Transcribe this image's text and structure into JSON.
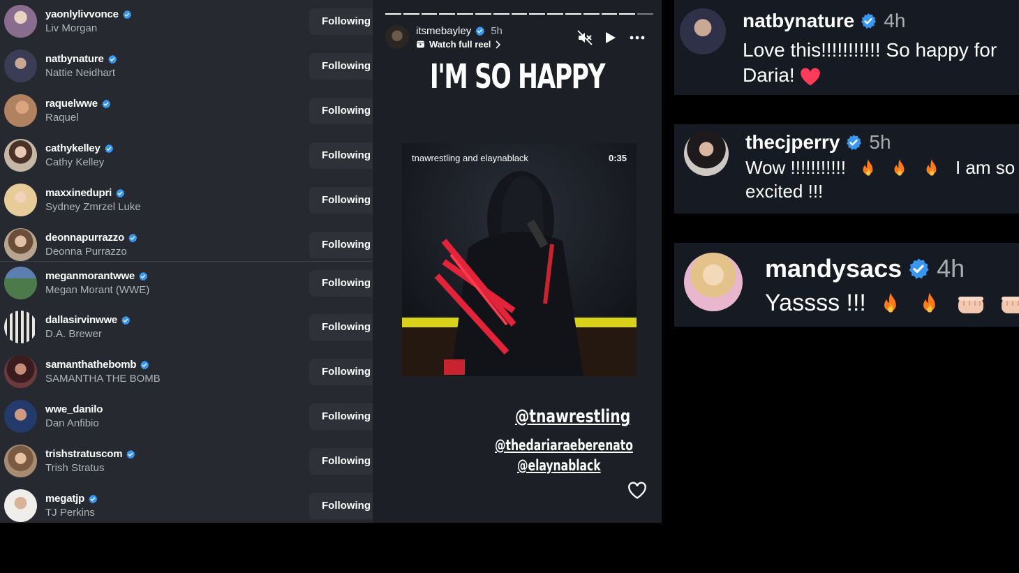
{
  "following": [
    {
      "username": "yaonlylivvonce",
      "name": "Liv Morgan",
      "button": "Following",
      "avatar_bg": "#8a6c8e"
    },
    {
      "username": "natbynature",
      "name": "Nattie Neidhart",
      "button": "Following",
      "avatar_bg": "#3a3d55"
    },
    {
      "username": "raquelwwe",
      "name": "Raquel",
      "button": "Following",
      "avatar_bg": "#b0825f"
    },
    {
      "username": "cathykelley",
      "name": "Cathy Kelley",
      "button": "Following",
      "avatar_bg": "#c7b8a5"
    },
    {
      "username": "maxxinedupri",
      "name": "Sydney Zmrzel Luke",
      "button": "Following",
      "avatar_bg": "#d4b896"
    },
    {
      "username": "deonnapurrazzo",
      "name": "Deonna Purrazzo",
      "button": "Following",
      "avatar_bg": "#9a8470"
    },
    {
      "username": "meganmorantwwe",
      "name": "Megan Morant (WWE)",
      "button": "Following",
      "avatar_bg": "#4d7a4a"
    },
    {
      "username": "dallasirvinwwe",
      "name": "D.A. Brewer",
      "button": "Following",
      "avatar_bg": "#6a6660"
    },
    {
      "username": "samanthathebomb",
      "name": "SAMANTHA THE BOMB",
      "button": "Following",
      "avatar_bg": "#6b3a3c"
    },
    {
      "username": "wwe_danilo",
      "name": "Dan Anfibio",
      "button": "Following",
      "avatar_bg": "#7c4d4a"
    },
    {
      "username": "trishstratuscom",
      "name": "Trish Stratus",
      "button": "Following",
      "avatar_bg": "#a68a72"
    },
    {
      "username": "megatjp",
      "name": "TJ Perkins",
      "button": "Following",
      "avatar_bg": "#c2b8b0"
    }
  ],
  "story": {
    "username": "itsmebayley",
    "time": "5h",
    "watch_label": "Watch full reel",
    "headline": "I'M SO HAPPY",
    "video_label": "tnawrestling and elaynablack",
    "video_duration": "0:35",
    "mentions": [
      "@tnawrestling",
      "@thedariaraeberenato",
      "@elaynablack"
    ],
    "icons": [
      "mute-icon",
      "play-icon",
      "more-icon",
      "heart-icon"
    ]
  },
  "comments": [
    {
      "username": "natbynature",
      "time": "4h",
      "lines": [
        "Love this!!!!!!!!!!! So happy for",
        "Daria! "
      ],
      "emoji": [
        "red-heart"
      ]
    },
    {
      "username": "thecjperry",
      "time": "5h",
      "lines": [
        "Wow !!!!!!!!!!!",
        "excited !!!"
      ],
      "middle_text": "I am so",
      "emoji": [
        "fire",
        "fire",
        "fire"
      ]
    },
    {
      "username": "mandysacs",
      "time": "4h",
      "lines": [
        "Yassss !!!"
      ],
      "emoji": [
        "fire",
        "fire",
        "fist",
        "fist"
      ]
    }
  ],
  "colors": {
    "verified": "#3897f0",
    "list_bg": "#262a30",
    "story_bg": "#1c1f25",
    "comment_bg": "#161a22",
    "heart": "#ff3040",
    "fire": "#ff7a1a"
  }
}
